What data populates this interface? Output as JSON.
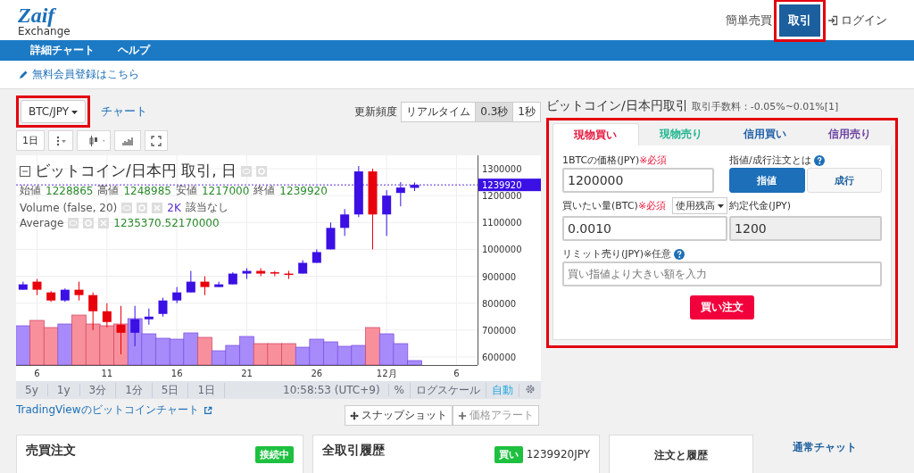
{
  "header": {
    "logo": "Zaif",
    "logo_sub": "Exchange",
    "nav": [
      {
        "label": "簡単売買",
        "selected": false,
        "highlighted": false
      },
      {
        "label": "取引",
        "selected": true,
        "highlighted": true
      },
      {
        "label": "ログイン",
        "selected": false,
        "highlighted": false
      }
    ]
  },
  "menu": [
    "詳細チャート",
    "ヘルプ"
  ],
  "signup_link": "無料会員登録はこちら",
  "pair_dropdown": {
    "label": "BTC/JPY",
    "highlighted": true
  },
  "chart_tab": "チャート",
  "refresh": {
    "label": "更新頻度",
    "options": [
      {
        "label": "リアルタイム",
        "selected": false
      },
      {
        "label": "0.3秒",
        "selected": true
      },
      {
        "label": "1秒",
        "selected": false
      }
    ]
  },
  "chart": {
    "interval": "1日",
    "title": "ビットコイン/日本円 取引, 日",
    "ohlc": [
      {
        "label": "始値",
        "value": "1228865"
      },
      {
        "label": "高値",
        "value": "1248985"
      },
      {
        "label": "安値",
        "value": "1217000"
      },
      {
        "label": "終値",
        "value": "1239920"
      }
    ],
    "volume_label": "Volume (false, 20)",
    "volume_value": "2K",
    "volume_note": "該当なし",
    "average_label": "Average",
    "average_value": "1235370.52170000",
    "ranges": [
      "5y",
      "1y",
      "3分",
      "1分",
      "5日",
      "1日"
    ],
    "last_price": "1239920",
    "chart_data": {
      "type": "candlestick",
      "grid": true,
      "categories": [
        null,
        "6",
        null,
        null,
        null,
        null,
        "11",
        null,
        null,
        null,
        null,
        "16",
        null,
        null,
        null,
        null,
        "21",
        null,
        null,
        null,
        null,
        "26",
        null,
        null,
        null,
        null,
        "12月",
        null,
        null,
        null,
        null,
        "6",
        null
      ],
      "ohlc": [
        [
          850000,
          880000,
          850000,
          870000
        ],
        [
          880000,
          890000,
          830000,
          850000
        ],
        [
          840000,
          845000,
          805000,
          810000
        ],
        [
          810000,
          855000,
          805000,
          850000
        ],
        [
          850000,
          880000,
          810000,
          830000
        ],
        [
          830000,
          840000,
          700000,
          770000
        ],
        [
          770000,
          800000,
          710000,
          730000
        ],
        [
          720000,
          790000,
          610000,
          690000
        ],
        [
          690000,
          790000,
          640000,
          740000
        ],
        [
          740000,
          780000,
          720000,
          750000
        ],
        [
          760000,
          820000,
          750000,
          810000
        ],
        [
          810000,
          860000,
          800000,
          840000
        ],
        [
          840000,
          920000,
          840000,
          880000
        ],
        [
          880000,
          900000,
          830000,
          860000
        ],
        [
          860000,
          880000,
          860000,
          870000
        ],
        [
          870000,
          915000,
          870000,
          910000
        ],
        [
          910000,
          930000,
          890000,
          920000
        ],
        [
          920000,
          930000,
          900000,
          910000
        ],
        [
          915000,
          920000,
          900000,
          910000
        ],
        [
          910000,
          920000,
          890000,
          907000
        ],
        [
          910000,
          960000,
          910000,
          950000
        ],
        [
          950000,
          1000000,
          950000,
          990000
        ],
        [
          1000000,
          1100000,
          1000000,
          1080000
        ],
        [
          1080000,
          1150000,
          1050000,
          1130000
        ],
        [
          1130000,
          1310000,
          1120000,
          1290000
        ],
        [
          1290000,
          1300000,
          1000000,
          1130000
        ],
        [
          1130000,
          1220000,
          1050000,
          1200000
        ],
        [
          1210000,
          1250000,
          1160000,
          1230000
        ],
        [
          1228865,
          1248985,
          1217000,
          1239920
        ],
        null,
        null,
        null,
        null
      ],
      "yticks": [
        1300000,
        1200000,
        1100000,
        1000000,
        900000,
        800000,
        700000,
        600000
      ],
      "ylim": [
        570000,
        1350000
      ]
    },
    "time": "10:58:53 (UTC+9)",
    "percent": "%",
    "log_scale": "ログスケール",
    "auto": "自動"
  },
  "tradingview_link": "TradingViewのビットコインチャート",
  "snapshot_button": "スナップショット",
  "alert_button": "価格アラート",
  "order": {
    "title": "ビットコイン/日本円取引",
    "fee": "取引手数料：-0.05%~0.01%[1]",
    "highlighted": true,
    "tabs": [
      {
        "label": "現物買い",
        "selected": true,
        "color": "#e8173c"
      },
      {
        "label": "現物売り",
        "selected": false,
        "color": "#1fb58f"
      },
      {
        "label": "信用買い",
        "selected": false,
        "color": "#1e5fa8"
      },
      {
        "label": "信用売り",
        "selected": false,
        "color": "#6b3fa0"
      }
    ],
    "price_label": "1BTCの価格(JPY)",
    "price_required": "※必須",
    "price": "1200000",
    "order_type_label": "指値/成行注文とは",
    "order_types": [
      {
        "label": "指値",
        "selected": true
      },
      {
        "label": "成行",
        "selected": false
      }
    ],
    "amount_label": "買いたい量(BTC)",
    "amount_required": "※必須",
    "balance_button": "使用残高",
    "amount": "0.0010",
    "total_label": "約定代金(JPY)",
    "total": "1200",
    "limit_label": "リミット売り(JPY)※任意",
    "limit_placeholder": "買い指値より大きい額を入力",
    "submit": "買い注文"
  },
  "panels": [
    {
      "title": "売買注文",
      "badge": "接続中"
    },
    {
      "title": "全取引履歴",
      "badge": "買い",
      "price": "1239920JPY"
    }
  ],
  "side_tabs": [
    {
      "label": "注文と履歴",
      "selected": true
    },
    {
      "label": "通常チャット",
      "selected": false
    }
  ]
}
